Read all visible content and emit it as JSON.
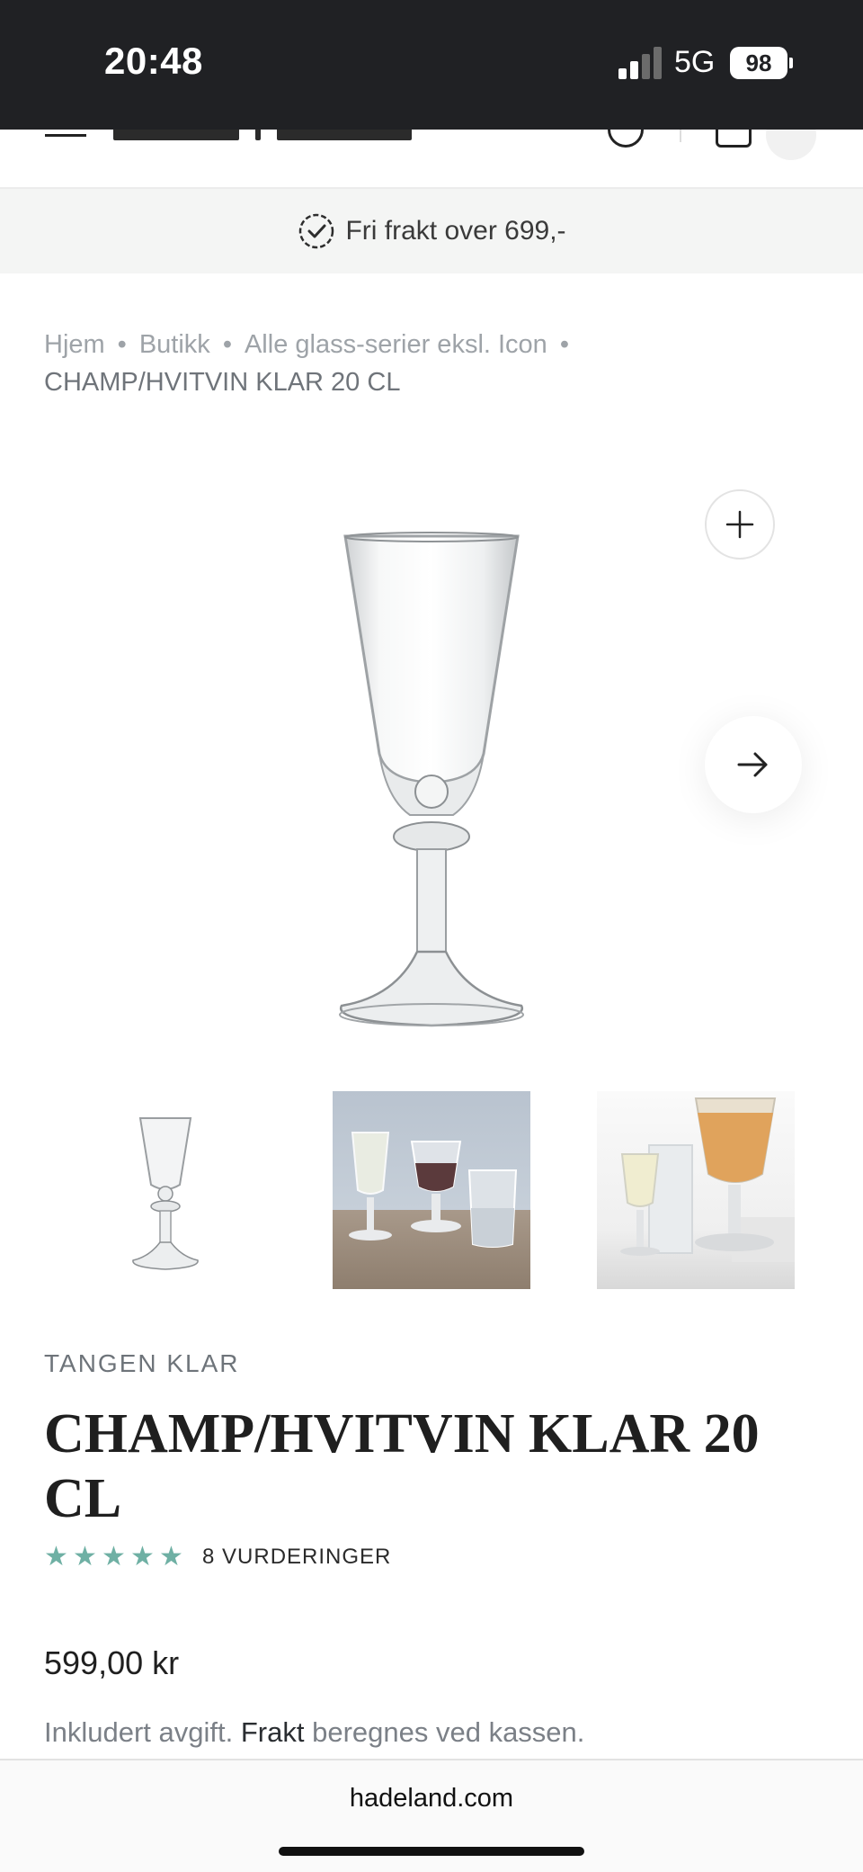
{
  "status_bar": {
    "time": "20:48",
    "network": "5G",
    "battery": "98"
  },
  "promo": {
    "text": "Fri frakt over 699,-",
    "icon": "check-badge-icon"
  },
  "breadcrumb": {
    "items": [
      "Hjem",
      "Butikk",
      "Alle glass-serier eksl. Icon"
    ],
    "current": "CHAMP/HVITVIN KLAR 20 CL"
  },
  "gallery": {
    "zoom_icon": "plus-icon",
    "next_icon": "arrow-right-icon"
  },
  "product": {
    "vendor": "TANGEN KLAR",
    "title": "CHAMP/HVITVIN KLAR 20 CL",
    "rating_value": 5,
    "rating_count_label": "8 VURDERINGER",
    "price": "599,00 kr",
    "tax_prefix": "Inkludert avgift.",
    "tax_link": "Frakt",
    "tax_suffix": "beregnes ved kassen."
  },
  "browser": {
    "url": "hadeland.com"
  },
  "colors": {
    "accent_star": "#6fb0a4",
    "status_bar": "#202124",
    "promo_bg": "#f4f5f4"
  }
}
